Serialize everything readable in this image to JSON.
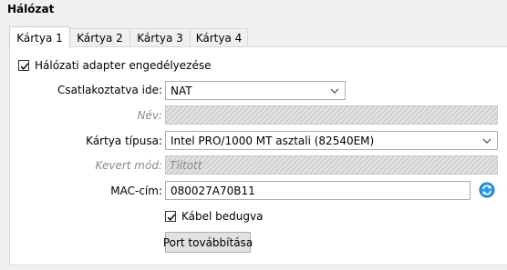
{
  "section": {
    "title": "Hálózat"
  },
  "tabs": [
    {
      "label": "Kártya 1"
    },
    {
      "label": "Kártya 2"
    },
    {
      "label": "Kártya 3"
    },
    {
      "label": "Kártya 4"
    }
  ],
  "active_tab": "Kártya 1",
  "adapter": {
    "enable_label": "Hálózati adapter engedélyezése",
    "enable_checked": true,
    "attached_label": "Csatlakoztatva ide:",
    "attached_value": "NAT",
    "name_label": "Név:",
    "name_value": "",
    "type_label": "Kártya típusa:",
    "type_value": "Intel PRO/1000 MT asztali (82540EM)",
    "promisc_label": "Kevert mód:",
    "promisc_value": "Tiltott",
    "mac_label": "MAC-cím:",
    "mac_value": "080027A70B11",
    "cable_label": "Kábel bedugva",
    "cable_checked": true,
    "port_forward_label": "Port továbbítása"
  },
  "icons": {
    "refresh": "refresh-icon",
    "chevron": "chevron-down-icon",
    "check": "checkmark-icon"
  },
  "colors": {
    "refresh_icon": "#1a8fd8",
    "disabled_text": "#8a8a8a"
  }
}
